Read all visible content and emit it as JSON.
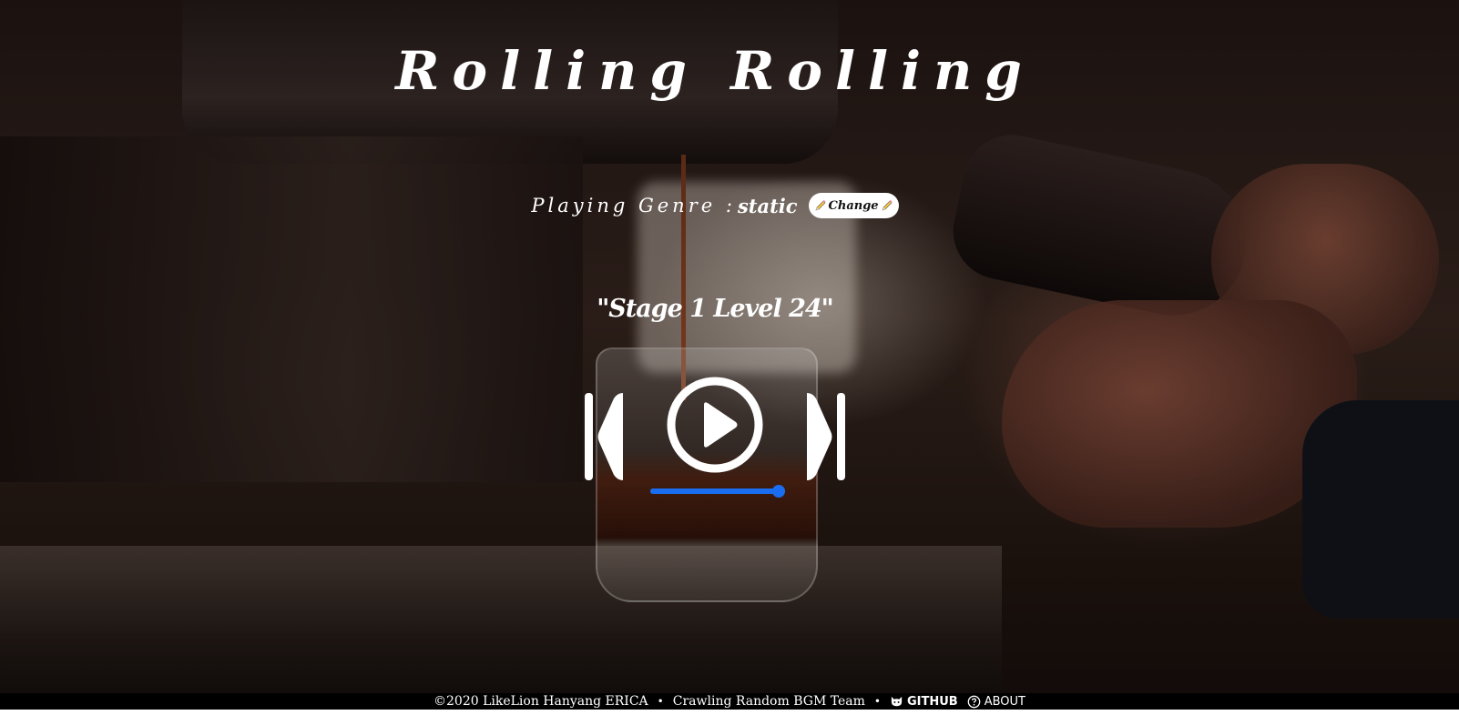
{
  "header": {
    "title": "Rolling Rolling"
  },
  "genre": {
    "label": "Playing Genre : ",
    "value": "static",
    "change_button_label": "Change",
    "change_button_icons": [
      "pencil-icon",
      "pencil-icon"
    ]
  },
  "player": {
    "track_title": "\"Stage 1 Level 24\"",
    "controls": {
      "prev_icon": "skip-previous-icon",
      "play_icon": "play-circle-icon",
      "next_icon": "skip-next-icon"
    },
    "progress_fraction": 0.95,
    "accent_color": "#1a6df0"
  },
  "footer": {
    "copyright": "©2020 LikeLion Hanyang ERICA",
    "separator": "•",
    "team": "Crawling Random BGM Team",
    "github_label": "GITHUB",
    "github_icon": "github-cat-icon",
    "about_label": "ABOUT",
    "about_icon": "question-circle-icon"
  }
}
